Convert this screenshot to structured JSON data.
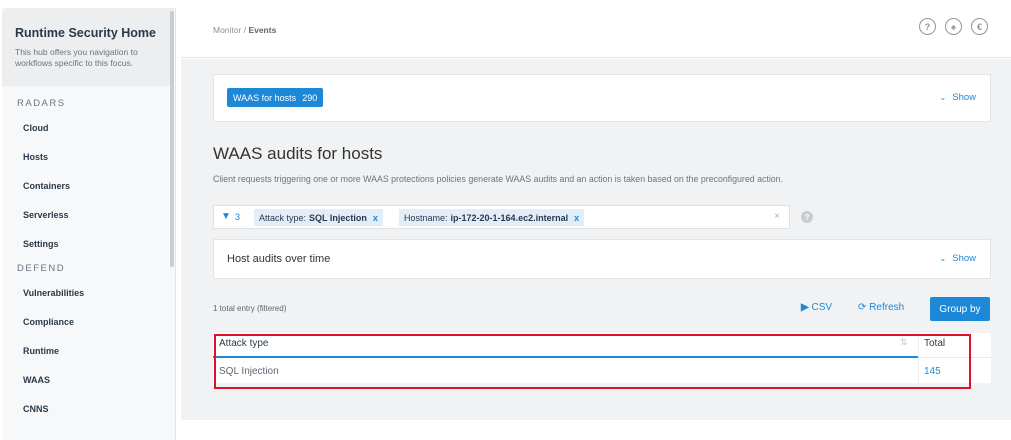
{
  "sidebar": {
    "title": "Runtime Security Home",
    "description_line1": "This hub offers you navigation to",
    "description_line2": "workflows specific to this focus.",
    "radars_label": "RADARS",
    "radars": [
      "Cloud",
      "Hosts",
      "Containers",
      "Serverless",
      "Settings"
    ],
    "defend_label": "DEFEND",
    "defend": [
      "Vulnerabilities",
      "Compliance",
      "Runtime",
      "WAAS",
      "CNNS"
    ]
  },
  "breadcrumb": {
    "parent": "Monitor",
    "separator": " / ",
    "current": "Events"
  },
  "top_icons": [
    "?",
    "♠",
    "€"
  ],
  "waas_badge": {
    "label": "WAAS for hosts",
    "count": "290"
  },
  "show_label": "Show",
  "page_title": "WAAS audits for hosts",
  "page_subtitle": "Client requests triggering one or more WAAS protections policies generate WAAS audits and an action is taken based on the preconfigured action.",
  "filters": {
    "count": "3",
    "chip1_key": "Attack type:",
    "chip1_value": "SQL Injection",
    "chip2_key": "Hostname:",
    "chip2_value": "ip-172-20-1-164.ec2.internal",
    "remove": "x",
    "clear": "×",
    "help": "?"
  },
  "host_audits_title": "Host audits over time",
  "total_entry": "1 total entry (filtered)",
  "actions": {
    "csv": "CSV",
    "refresh": "Refresh",
    "group_by": "Group by"
  },
  "table": {
    "columns": [
      "Attack type",
      "Total"
    ],
    "rows": [
      {
        "attack_type": "SQL Injection",
        "total": "145"
      }
    ]
  },
  "colors": {
    "accent": "#1e88d8",
    "highlight": "#e0102a"
  }
}
